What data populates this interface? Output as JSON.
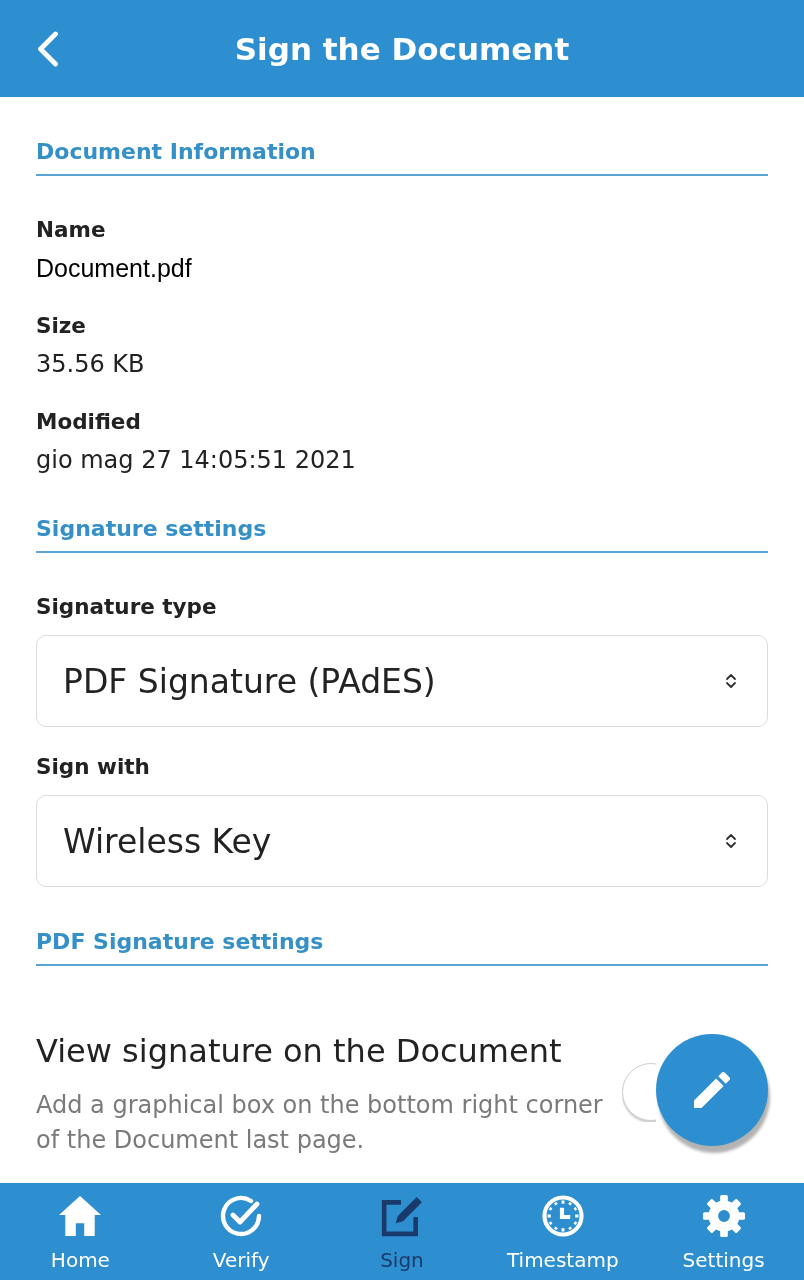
{
  "header": {
    "title": "Sign the Document"
  },
  "sections": [
    {
      "title": "Document Information",
      "fields": [
        {
          "kind": "info",
          "label": "Name",
          "value": "Document.pdf"
        },
        {
          "kind": "info",
          "label": "Size",
          "value": "35.56 KB"
        },
        {
          "kind": "info",
          "label": "Modified",
          "value": "gio mag 27 14:05:51 2021"
        }
      ]
    },
    {
      "title": "Signature settings",
      "fields": [
        {
          "kind": "select",
          "label": "Signature type",
          "value": "PDF Signature (PAdES)"
        },
        {
          "kind": "select",
          "label": "Sign with",
          "value": "Wireless Key"
        }
      ]
    },
    {
      "title": "PDF Signature settings",
      "fields": [
        {
          "kind": "toggle",
          "label": "View signature on the Document",
          "description": "Add a graphical box on the bottom right corner of the Document last page.",
          "checked": false
        }
      ]
    }
  ],
  "nav": [
    {
      "label": "Home",
      "selected": false
    },
    {
      "label": "Verify",
      "selected": false
    },
    {
      "label": "Sign",
      "selected": true
    },
    {
      "label": "Timestamp",
      "selected": false
    },
    {
      "label": "Settings",
      "selected": false
    }
  ]
}
